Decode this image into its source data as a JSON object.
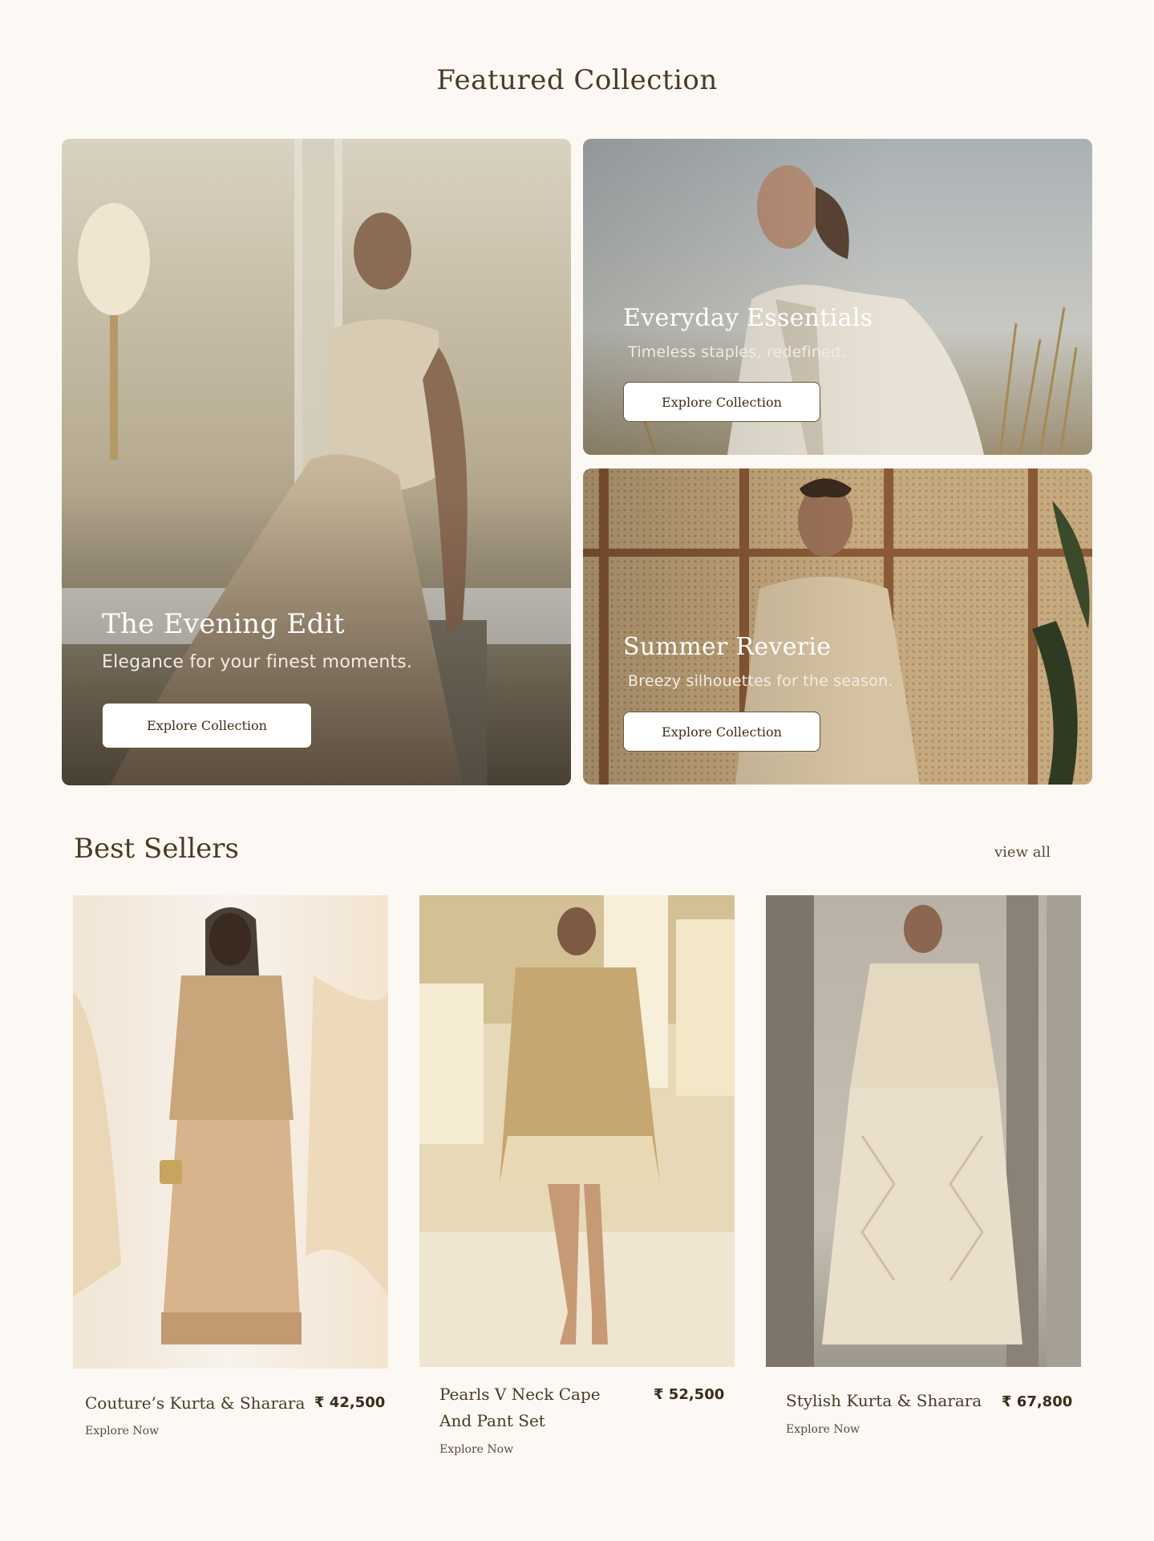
{
  "featured": {
    "title": "Featured Collection",
    "cards": [
      {
        "title": "The Evening Edit",
        "subtitle": "Elegance for your finest moments.",
        "button": "Explore Collection"
      },
      {
        "title": "Everyday Essentials",
        "subtitle": "Timeless staples, redefined.",
        "button": "Explore Collection"
      },
      {
        "title": "Summer Reverie",
        "subtitle": "Breezy silhouettes for the season.",
        "button": "Explore Collection"
      }
    ]
  },
  "best_sellers": {
    "title": "Best Sellers",
    "view_all": "view all",
    "products": [
      {
        "name": "Couture’s  Kurta & Sharara",
        "price": "₹ 42,500",
        "link": "Explore Now"
      },
      {
        "name_line1": "Pearls V Neck Cape",
        "name_line2": "And Pant Set",
        "price": "₹ 52,500",
        "link": "Explore Now"
      },
      {
        "name": "Stylish Kurta & Sharara",
        "price": "₹ 67,800",
        "link": "Explore Now"
      }
    ]
  },
  "colors": {
    "background": "#fcf9f4",
    "heading": "#4a3a24",
    "button_border": "#6b5535"
  }
}
